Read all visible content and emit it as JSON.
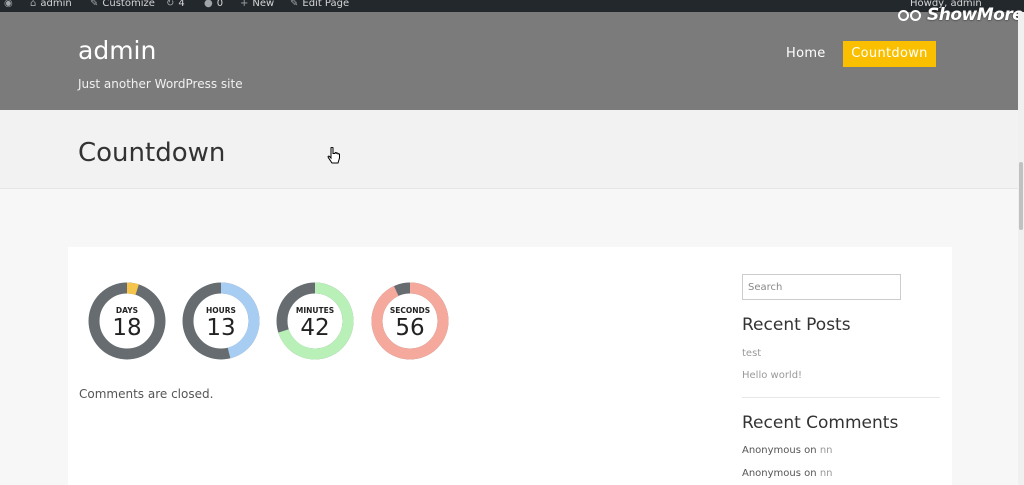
{
  "admin_bar": {
    "site_name": "admin",
    "customize_label": "Customize",
    "updates_count": "4",
    "comments_count": "0",
    "new_label": "New",
    "edit_label": "Edit Page",
    "howdy_label": "Howdy, admin"
  },
  "watermark": {
    "text": "ShowMore"
  },
  "header": {
    "site_title": "admin",
    "tagline": "Just another WordPress site",
    "nav": [
      {
        "label": "Home",
        "active": false
      },
      {
        "label": "Countdown",
        "active": true
      }
    ]
  },
  "page": {
    "title": "Countdown"
  },
  "countdown": {
    "units": [
      {
        "label": "DAYS",
        "value": "18",
        "color": "#f5c44c",
        "fraction": 0.05
      },
      {
        "label": "HOURS",
        "value": "13",
        "color": "#a8cdf2",
        "fraction": 0.46
      },
      {
        "label": "MINUTES",
        "value": "42",
        "color": "#b8f0b8",
        "fraction": 0.7
      },
      {
        "label": "SECONDS",
        "value": "56",
        "color": "#f5a89c",
        "fraction": 0.93
      }
    ],
    "track_color": "#666c70"
  },
  "comments_closed": "Comments are closed.",
  "sidebar": {
    "search_placeholder": "Search",
    "recent_posts_heading": "Recent Posts",
    "recent_posts": [
      "test",
      "Hello world!"
    ],
    "recent_comments_heading": "Recent Comments",
    "recent_comments": [
      {
        "author": "Anonymous",
        "on": "on",
        "post": "nn"
      },
      {
        "author": "Anonymous",
        "on": "on",
        "post": "nn"
      }
    ]
  },
  "colors": {
    "header_bg": "#7b7b7b",
    "accent": "#fac000",
    "admin_bar_bg": "#23282d"
  }
}
